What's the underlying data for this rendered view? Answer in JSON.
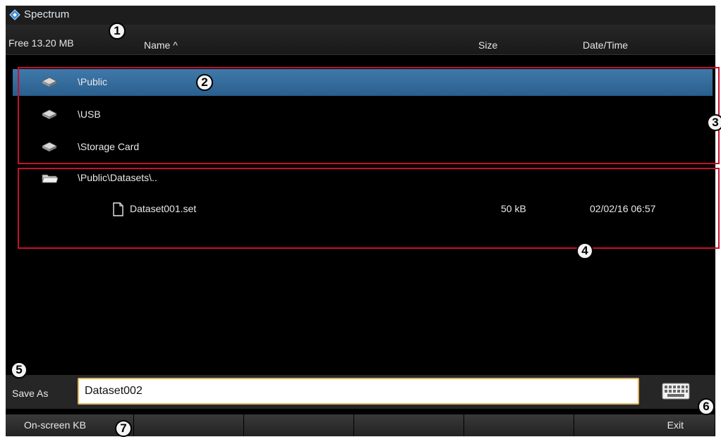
{
  "app": {
    "title": "Spectrum"
  },
  "header": {
    "free_space": "Free  13.20 MB",
    "col_name": "Name ^",
    "col_size": "Size",
    "col_datetime": "Date/Time"
  },
  "drives": [
    {
      "label": "\\Public",
      "icon": "drive-icon",
      "selected": true
    },
    {
      "label": "\\USB",
      "icon": "drive-icon",
      "selected": false
    },
    {
      "label": "\\Storage Card",
      "icon": "drive-icon",
      "selected": false
    }
  ],
  "folder": {
    "path": "\\Public\\Datasets\\..",
    "icon": "folder-icon",
    "files": [
      {
        "name": "Dataset001.set",
        "size": "50 kB",
        "datetime": "02/02/16 06:57",
        "icon": "file-icon"
      }
    ]
  },
  "save": {
    "label": "Save As",
    "value": "Dataset002",
    "keyboard_icon": "keyboard-icon"
  },
  "softkeys": [
    "On-screen KB",
    "",
    "",
    "",
    "",
    "Exit"
  ],
  "callouts": [
    "1",
    "2",
    "3",
    "4",
    "5",
    "6",
    "7"
  ],
  "colors": {
    "selection": "#3a70a0",
    "highlight_box": "#c8102e",
    "logo": "#3a8ad6",
    "input_border": "#e0b860"
  }
}
